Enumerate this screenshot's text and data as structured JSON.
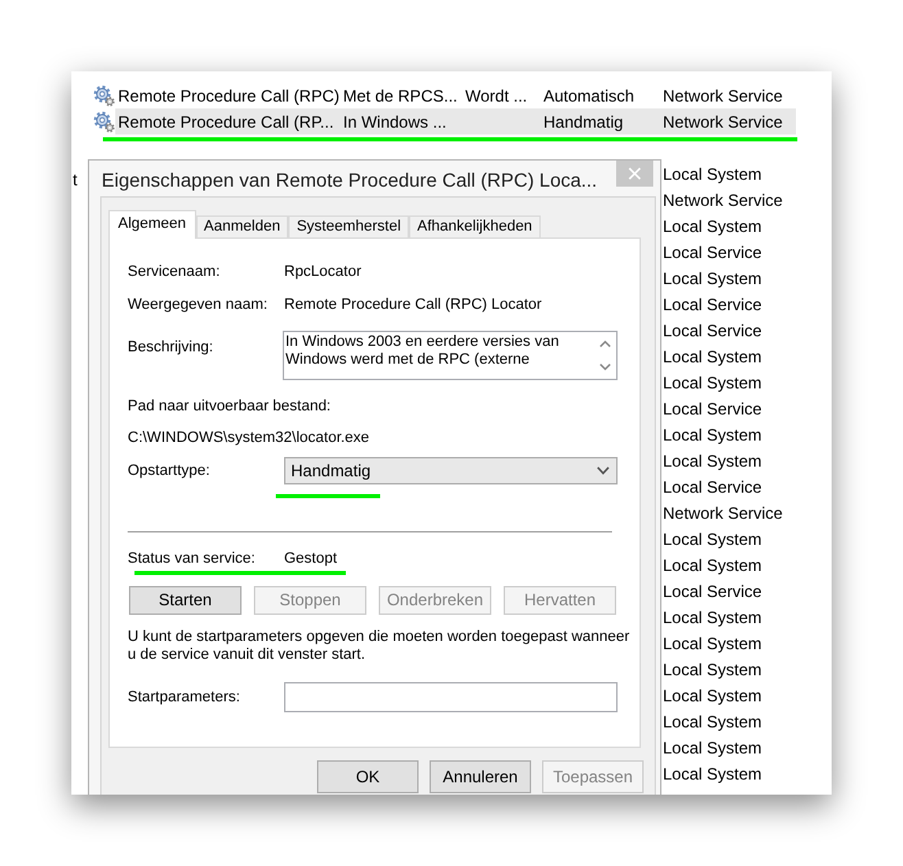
{
  "services": {
    "rows": [
      {
        "kind": "full",
        "name": "Remote Procedure Call (RPC)",
        "description": "Met de RPCS...",
        "status": "Wordt ...",
        "startup_type": "Automatisch",
        "log_on_as": "Network Service",
        "selected": false,
        "highlighted": false
      },
      {
        "kind": "full",
        "name": "Remote Procedure Call (RP...",
        "description": "In Windows ...",
        "startup_type": "Handmatig",
        "log_on_as": "Network Service",
        "selected": true,
        "highlighted": true
      },
      {
        "kind": "covered",
        "log_on_as": "Local System",
        "selected": false,
        "highlighted": false
      },
      {
        "kind": "covered",
        "log_on_as": "Network Service",
        "selected": false,
        "highlighted": false
      },
      {
        "kind": "covered",
        "log_on_as": "Local System",
        "selected": false,
        "highlighted": false
      },
      {
        "kind": "covered",
        "log_on_as": "Local Service",
        "selected": false,
        "highlighted": false
      },
      {
        "kind": "covered",
        "log_on_as": "Local System",
        "selected": false,
        "highlighted": false
      },
      {
        "kind": "covered",
        "log_on_as": "Local Service",
        "selected": false,
        "highlighted": false
      },
      {
        "kind": "covered",
        "log_on_as": "Local Service",
        "selected": false,
        "highlighted": false
      },
      {
        "kind": "covered",
        "log_on_as": "Local System",
        "selected": false,
        "highlighted": false
      },
      {
        "kind": "covered",
        "log_on_as": "Local System",
        "selected": false,
        "highlighted": false
      },
      {
        "kind": "covered",
        "log_on_as": "Local Service",
        "selected": false,
        "highlighted": false
      },
      {
        "kind": "covered",
        "log_on_as": "Local System",
        "selected": false,
        "highlighted": false
      },
      {
        "kind": "covered",
        "log_on_as": "Local System",
        "selected": false,
        "highlighted": false
      },
      {
        "kind": "covered",
        "log_on_as": "Local Service",
        "selected": false,
        "highlighted": false
      },
      {
        "kind": "covered",
        "log_on_as": "Network Service",
        "selected": false,
        "highlighted": false
      },
      {
        "kind": "covered",
        "log_on_as": "Local System",
        "selected": false,
        "highlighted": false
      },
      {
        "kind": "covered",
        "log_on_as": "Local System",
        "selected": false,
        "highlighted": false
      },
      {
        "kind": "covered",
        "log_on_as": "Local Service",
        "selected": false,
        "highlighted": false
      },
      {
        "kind": "covered",
        "log_on_as": "Local System",
        "selected": false,
        "highlighted": false
      },
      {
        "kind": "covered",
        "log_on_as": "Local System",
        "selected": false,
        "highlighted": false
      },
      {
        "kind": "covered",
        "log_on_as": "Local System",
        "selected": false,
        "highlighted": false
      },
      {
        "kind": "covered",
        "log_on_as": "Local System",
        "selected": false,
        "highlighted": false
      },
      {
        "kind": "covered",
        "log_on_as": "Local System",
        "selected": false,
        "highlighted": false
      },
      {
        "kind": "covered",
        "log_on_as": "Local System",
        "selected": false,
        "highlighted": false
      },
      {
        "kind": "covered",
        "log_on_as": "Local System",
        "selected": false,
        "highlighted": false
      }
    ]
  },
  "edge_text": "t",
  "dialog": {
    "title": "Eigenschappen van Remote Procedure Call (RPC) Loca...",
    "tabs": [
      {
        "label": "Algemeen",
        "selected": true
      },
      {
        "label": "Aanmelden",
        "selected": false
      },
      {
        "label": "Systeemherstel",
        "selected": false
      },
      {
        "label": "Afhankelijkheden",
        "selected": false
      }
    ],
    "general": {
      "service_name": {
        "label": "Servicenaam:",
        "value": "RpcLocator"
      },
      "display_name": {
        "label": "Weergegeven naam:",
        "value": "Remote Procedure Call (RPC) Locator"
      },
      "description": {
        "label": "Beschrijving:",
        "value": "In Windows 2003 en eerdere versies van Windows werd met de RPC (externe"
      },
      "executable_path": {
        "label": "Pad naar uitvoerbaar bestand:",
        "value": "C:\\WINDOWS\\system32\\locator.exe"
      },
      "startup_type": {
        "label": "Opstarttype:",
        "value": "Handmatig",
        "highlighted": true
      },
      "status": {
        "label": "Status van service:",
        "value": "Gestopt",
        "highlighted": true
      },
      "service_buttons": [
        {
          "label": "Starten",
          "disabled": false
        },
        {
          "label": "Stoppen",
          "disabled": true
        },
        {
          "label": "Onderbreken",
          "disabled": true
        },
        {
          "label": "Hervatten",
          "disabled": true
        }
      ],
      "hint": "U kunt de startparameters opgeven die moeten worden toegepast wanneer u de service vanuit dit venster start.",
      "start_parameters": {
        "label": "Startparameters:"
      }
    },
    "buttons": [
      {
        "label": "OK",
        "disabled": false
      },
      {
        "label": "Annuleren",
        "disabled": false
      },
      {
        "label": "Toepassen",
        "disabled": true
      }
    ]
  }
}
